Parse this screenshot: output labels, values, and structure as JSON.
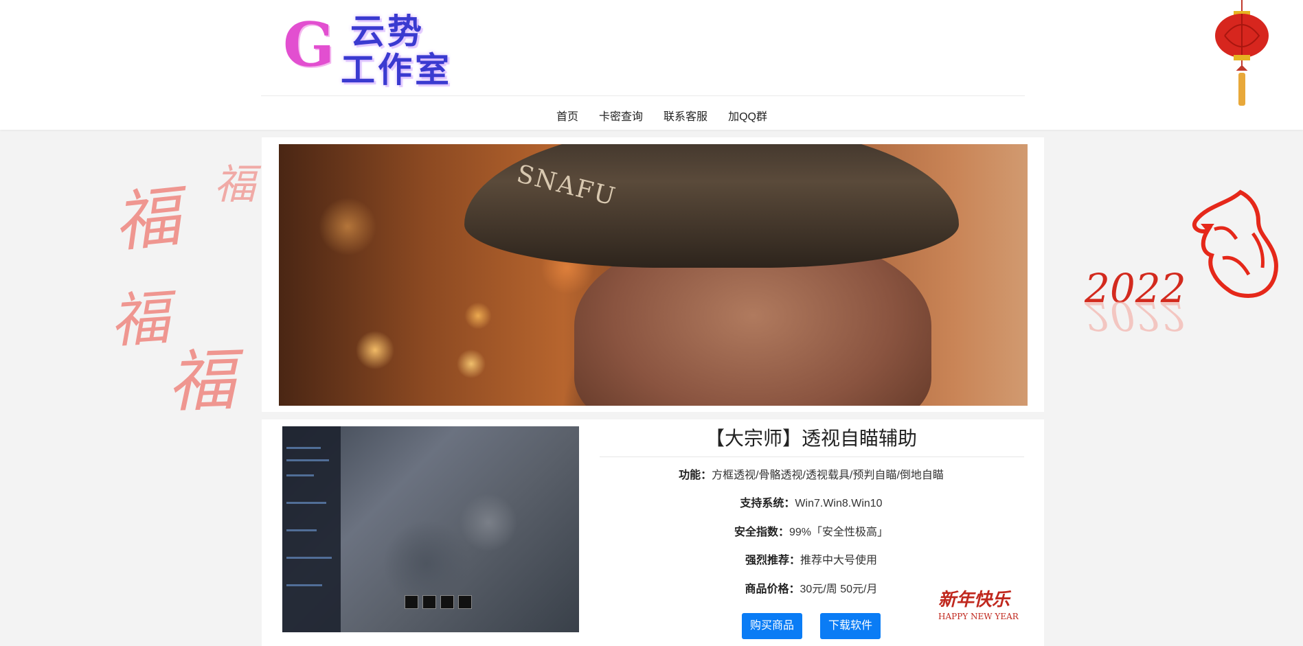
{
  "logo": {
    "letter": "G",
    "line1": "云势",
    "line2": "工作室"
  },
  "nav": {
    "items": [
      "首页",
      "卡密查询",
      "联系客服",
      "加QQ群"
    ]
  },
  "decorations": {
    "fu_char": "福",
    "year": "2022",
    "happy_cn": "新年快乐",
    "happy_en": "HAPPY NEW YEAR",
    "helmet_text": "SNAFU"
  },
  "product": {
    "title": "【大宗师】透视自瞄辅助",
    "features_label": "功能：",
    "features_value": "方框透视/骨骼透视/透视载具/预判自瞄/倒地自瞄",
    "system_label": "支持系统：",
    "system_value": "Win7.Win8.Win10",
    "safety_label": "安全指数：",
    "safety_value": "99%「安全性极高」",
    "recommend_label": "强烈推荐：",
    "recommend_value": "推荐中大号使用",
    "price_label": "商品价格：",
    "price_value": "30元/周 50元/月",
    "buy_label": "购买商品",
    "download_label": "下载软件"
  },
  "colors": {
    "button": "#0a7cf5",
    "logo_pink": "#e24fd0",
    "logo_blue": "#3a3ad0",
    "fu_red": "#ef8c86"
  }
}
